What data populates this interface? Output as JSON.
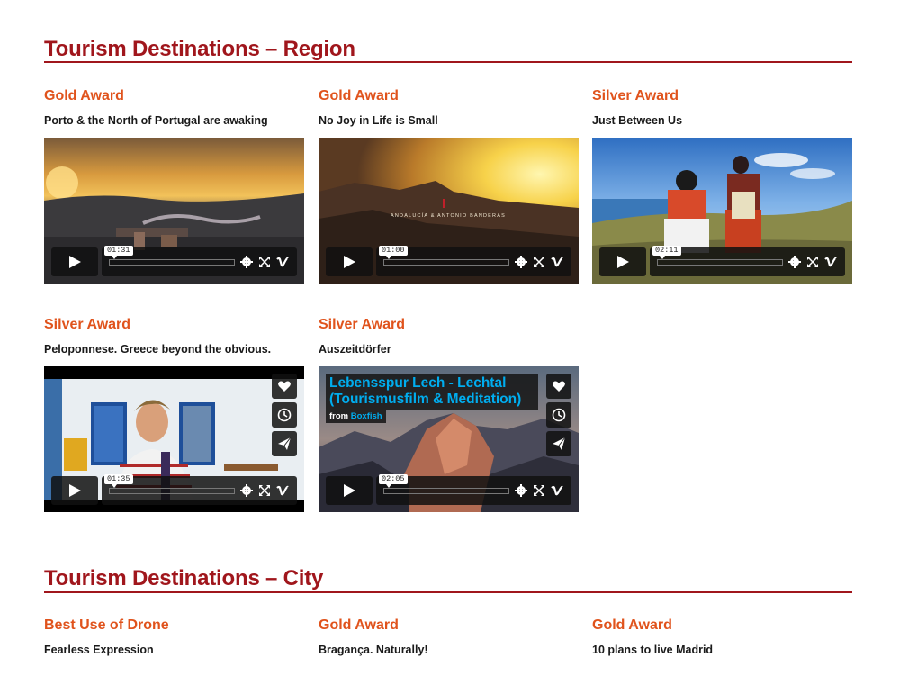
{
  "sections": [
    {
      "title": "Tourism Destinations – Region",
      "entries": [
        {
          "award": "Gold Award",
          "title": "Porto & the North of Portugal are awaking",
          "duration": "01:31"
        },
        {
          "award": "Gold Award",
          "title": "No Joy in Life is Small",
          "duration": "01:00",
          "overlay_text": "ANDALUCÍA & ANTONIO BANDERAS"
        },
        {
          "award": "Silver Award",
          "title": "Just Between Us",
          "duration": "02:11"
        },
        {
          "award": "Silver Award",
          "title": "Peloponnese. Greece beyond the obvious.",
          "duration": "01:35"
        },
        {
          "award": "Silver Award",
          "title": "Auszeitdörfer",
          "duration": "02:05",
          "video_title": "Lebensspur Lech - Lechtal (Tourismusfilm & Meditation)",
          "byline_prefix": "from",
          "byline_owner": "Boxfish"
        }
      ]
    },
    {
      "title": "Tourism Destinations – City",
      "entries": [
        {
          "award": "Best Use of Drone",
          "title": "Fearless Expression"
        },
        {
          "award": "Gold Award",
          "title": "Bragança. Naturally!"
        },
        {
          "award": "Gold Award",
          "title": "10 plans to live Madrid"
        }
      ]
    }
  ],
  "player_icons": {
    "play": "play-icon",
    "settings": "gear-icon",
    "fullscreen": "fullscreen-icon",
    "vimeo": "vimeo-logo-icon",
    "like": "heart-icon",
    "watch_later": "clock-icon",
    "share": "paper-plane-icon"
  },
  "colors": {
    "section_title": "#a0161c",
    "award": "#e0531c",
    "vimeo_blue": "#00adef"
  }
}
